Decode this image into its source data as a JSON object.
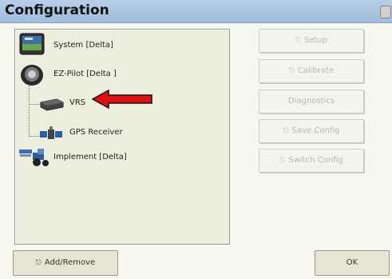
{
  "window": {
    "title": "Configuration"
  },
  "tree": {
    "items": [
      {
        "label": "System [Delta]",
        "icon": "display-icon"
      },
      {
        "label": "EZ-Pilot [Delta ]",
        "icon": "steering-motor-icon"
      },
      {
        "label": "VRS",
        "icon": "modem-icon"
      },
      {
        "label": "GPS Receiver",
        "icon": "satellite-icon"
      },
      {
        "label": "Implement [Delta]",
        "icon": "tractor-icon"
      }
    ]
  },
  "buttons": {
    "setup": "Setup",
    "calibrate": "Calibrate",
    "diagnostics": "Diagnostics",
    "save_config": "Save Config",
    "switch_config": "Switch Config",
    "add_remove": "Add/Remove",
    "ok": "OK"
  },
  "colors": {
    "title_bar": "#a9c4e2",
    "panel": "#eeeede",
    "disabled_text": "#b8b8a8",
    "arrow": "#e01010"
  }
}
